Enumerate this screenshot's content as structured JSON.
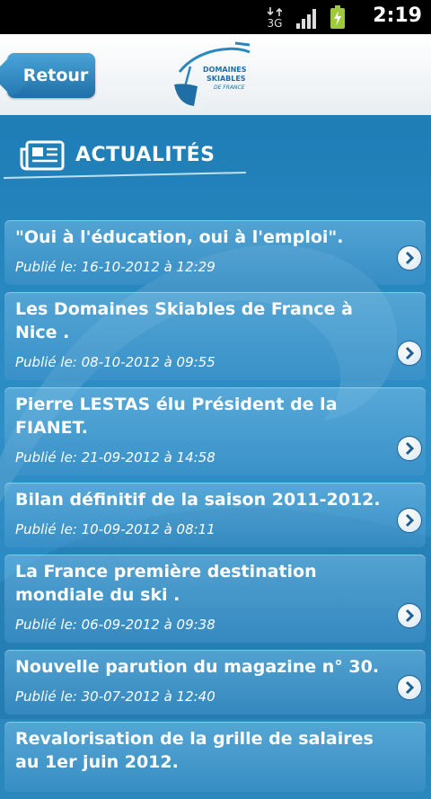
{
  "status_bar": {
    "time": "2:19",
    "network_label": "3G"
  },
  "header": {
    "back_label": "Retour",
    "logo_line1": "DOMAINES",
    "logo_line2": "SKIABLES",
    "logo_line3": "DE FRANCE"
  },
  "section": {
    "title": "ACTUALITÉS"
  },
  "news": [
    {
      "title": "\"Oui à l'éducation, oui à l'emploi\".",
      "date": "Publié le: 16-10-2012 à 12:29"
    },
    {
      "title": "Les Domaines Skiables de France à Nice .",
      "date": "Publié le: 08-10-2012 à 09:55"
    },
    {
      "title": "Pierre LESTAS élu Président de la FIANET.",
      "date": "Publié le: 21-09-2012 à 14:58"
    },
    {
      "title": "Bilan définitif de la saison 2011-2012.",
      "date": "Publié le: 10-09-2012 à 08:11"
    },
    {
      "title": "La France première destination mondiale du ski .",
      "date": "Publié le: 06-09-2012 à 09:38"
    },
    {
      "title": "Nouvelle parution du magazine n° 30.",
      "date": "Publié le: 30-07-2012 à 12:40"
    },
    {
      "title": "Revalorisation de la grille de salaires au 1er juin 2012.",
      "date": ""
    }
  ],
  "colors": {
    "accent": "#2b88bd",
    "header_bg": "#ffffff",
    "button": "#2378b0"
  }
}
